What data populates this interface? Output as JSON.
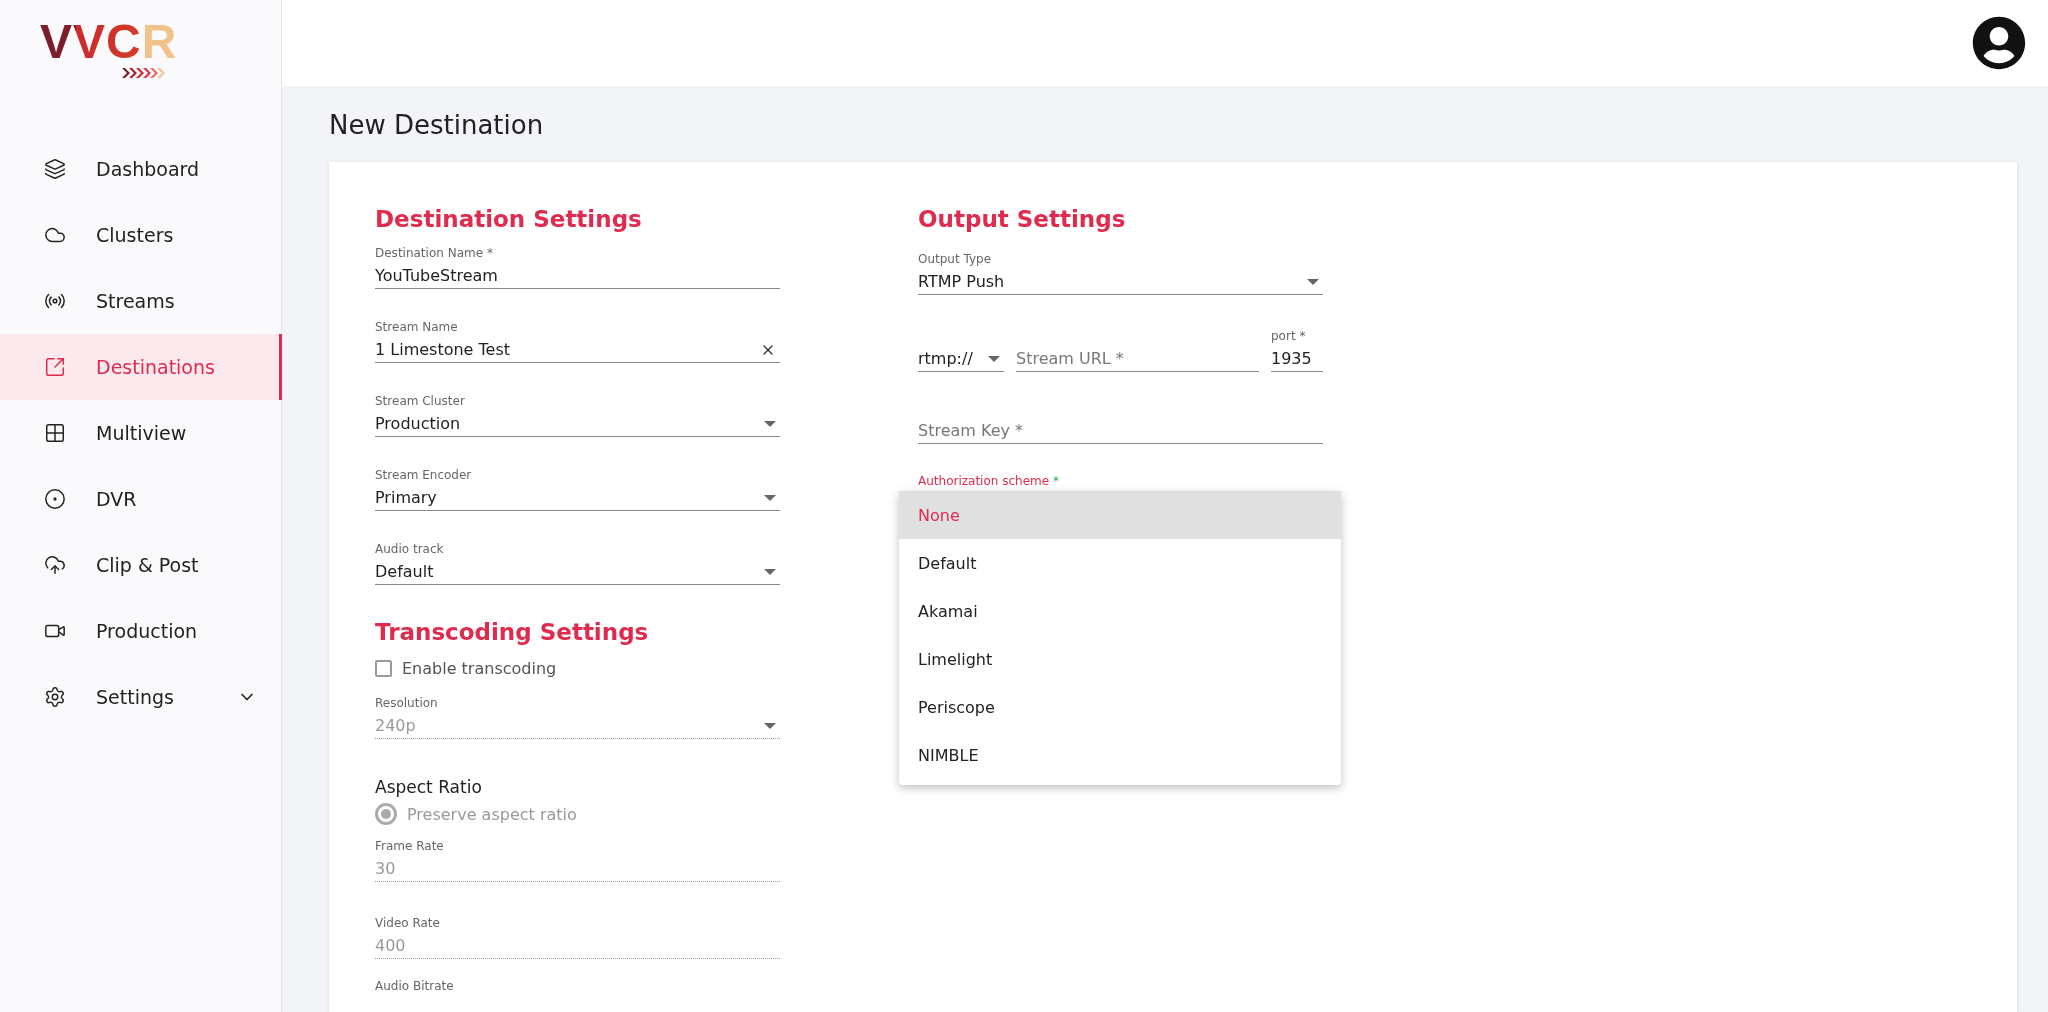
{
  "logo": {
    "text": "VVCR"
  },
  "sidebar": {
    "items": [
      {
        "label": "Dashboard",
        "kind": "link",
        "selected": false
      },
      {
        "label": "Clusters",
        "kind": "link",
        "selected": false
      },
      {
        "label": "Streams",
        "kind": "link",
        "selected": false
      },
      {
        "label": "Destinations",
        "kind": "link",
        "selected": true
      },
      {
        "label": "Multiview",
        "kind": "link",
        "selected": false
      },
      {
        "label": "DVR",
        "kind": "link",
        "selected": false
      },
      {
        "label": "Clip & Post",
        "kind": "link",
        "selected": false
      },
      {
        "label": "Production",
        "kind": "link",
        "selected": false
      },
      {
        "label": "Settings",
        "kind": "group",
        "selected": false,
        "expanded": false
      }
    ]
  },
  "page_title": "New Destination",
  "destination_settings": {
    "title": "Destination Settings",
    "fields": [
      {
        "kind": "text",
        "label": "Destination Name *",
        "value": "YouTubeStream"
      },
      {
        "kind": "clearable",
        "label": "Stream Name",
        "value": "1 Limestone Test"
      },
      {
        "kind": "select",
        "label": "Stream Cluster",
        "value": "Production"
      },
      {
        "kind": "select",
        "label": "Stream Encoder",
        "value": "Primary"
      },
      {
        "kind": "select",
        "label": "Audio track",
        "value": "Default"
      }
    ]
  },
  "transcoding_settings": {
    "title": "Transcoding Settings",
    "enable_transcoding": {
      "label": "Enable transcoding",
      "checked": false
    },
    "resolution": {
      "kind": "select",
      "label": "Resolution",
      "value": "240p",
      "disabled": true
    },
    "aspect_ratio": {
      "label": "Aspect Ratio",
      "options": [
        {
          "label": "Preserve aspect ratio",
          "selected": true,
          "disabled": true
        }
      ]
    },
    "frame_rate": {
      "kind": "text",
      "label": "Frame Rate",
      "value": "30",
      "disabled": true
    },
    "video_rate": {
      "kind": "text",
      "label": "Video Rate",
      "value": "400",
      "disabled": true
    },
    "audio_bitrate": {
      "label": "Audio Bitrate"
    }
  },
  "output_settings": {
    "title": "Output Settings",
    "output_type": {
      "label": "Output Type",
      "value": "RTMP Push"
    },
    "protocol": {
      "value": "rtmp://"
    },
    "stream_url": {
      "placeholder": "Stream URL *"
    },
    "port": {
      "label": "port *",
      "value": "1935"
    },
    "stream_key": {
      "placeholder": "Stream Key *"
    },
    "authorization": {
      "label": "Authorization scheme",
      "required_mark": "*",
      "options": [
        {
          "label": "None",
          "selected": true
        },
        {
          "label": "Default",
          "selected": false
        },
        {
          "label": "Akamai",
          "selected": false
        },
        {
          "label": "Limelight",
          "selected": false
        },
        {
          "label": "Periscope",
          "selected": false
        },
        {
          "label": "NIMBLE",
          "selected": false
        }
      ]
    }
  }
}
